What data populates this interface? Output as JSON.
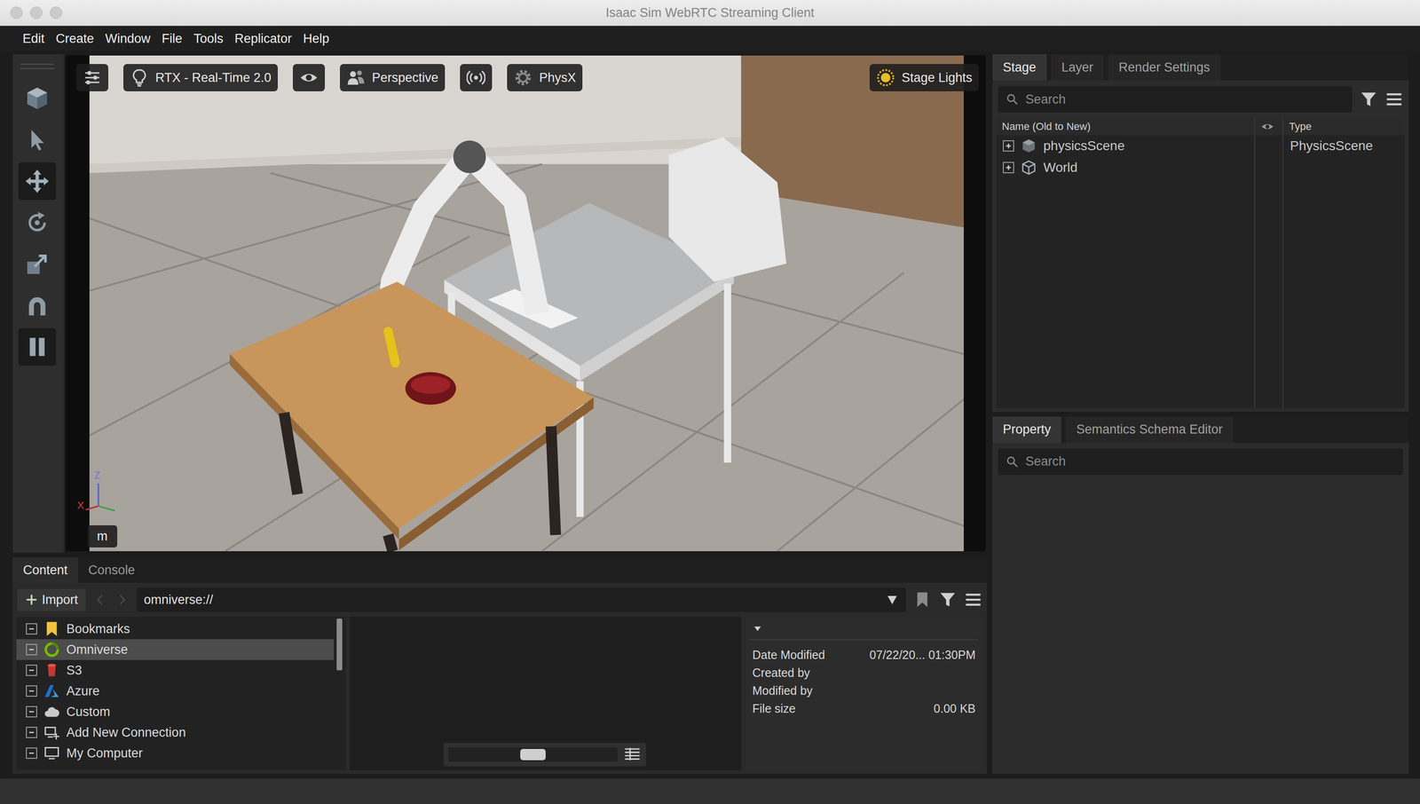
{
  "window": {
    "title": "Isaac Sim WebRTC Streaming Client"
  },
  "menu": [
    "Edit",
    "Create",
    "Window",
    "File",
    "Tools",
    "Replicator",
    "Help"
  ],
  "tools": [
    {
      "kind": "display",
      "selected": false
    },
    {
      "kind": "select",
      "selected": false
    },
    {
      "kind": "move",
      "selected": true
    },
    {
      "kind": "rotate",
      "selected": false
    },
    {
      "kind": "scale",
      "selected": false
    },
    {
      "kind": "snap",
      "selected": false
    },
    {
      "kind": "pause",
      "selected": true
    }
  ],
  "viewport": {
    "renderer": "RTX - Real-Time 2.0",
    "camera": "Perspective",
    "physics": "PhysX",
    "lights": "Stage Lights",
    "units": "m",
    "axes": {
      "up": "Z",
      "side": "X"
    }
  },
  "content": {
    "tabs": [
      {
        "label": "Content",
        "selected": true
      },
      {
        "label": "Console",
        "selected": false
      }
    ],
    "import": "Import",
    "path": "omniverse://",
    "tree": [
      {
        "label": "Bookmarks",
        "kind": "bookmark",
        "selected": false,
        "expanded": true
      },
      {
        "label": "Omniverse",
        "kind": "omniverse",
        "selected": true,
        "expanded": true
      },
      {
        "label": "S3",
        "kind": "s3",
        "selected": false,
        "expanded": true
      },
      {
        "label": "Azure",
        "kind": "azure",
        "selected": false,
        "expanded": true
      },
      {
        "label": "Custom",
        "kind": "cloud",
        "selected": false,
        "expanded": true
      },
      {
        "label": "Add New Connection",
        "kind": "connection",
        "selected": false,
        "expanded": true
      },
      {
        "label": "My Computer",
        "kind": "computer",
        "selected": false,
        "expanded": true
      }
    ],
    "details": [
      {
        "label": "Date Modified",
        "value": "07/22/20... 01:30PM"
      },
      {
        "label": "Created by",
        "value": ""
      },
      {
        "label": "Modified by",
        "value": ""
      },
      {
        "label": "File size",
        "value": "0.00 KB"
      }
    ]
  },
  "stage": {
    "tabs": [
      {
        "label": "Stage",
        "selected": true
      },
      {
        "label": "Layer",
        "selected": false
      },
      {
        "label": "Render Settings",
        "selected": false
      }
    ],
    "search": {
      "placeholder": "Search"
    },
    "columns": [
      "Name (Old to New)",
      "Type"
    ],
    "rows": [
      {
        "name": "physicsScene",
        "type": "PhysicsScene",
        "kind": "scene",
        "expanded": false
      },
      {
        "name": "World",
        "type": "",
        "kind": "xform",
        "expanded": false
      }
    ]
  },
  "property": {
    "tabs": [
      {
        "label": "Property",
        "selected": true
      },
      {
        "label": "Semantics Schema Editor",
        "selected": false
      }
    ],
    "search": {
      "placeholder": "Search"
    }
  }
}
